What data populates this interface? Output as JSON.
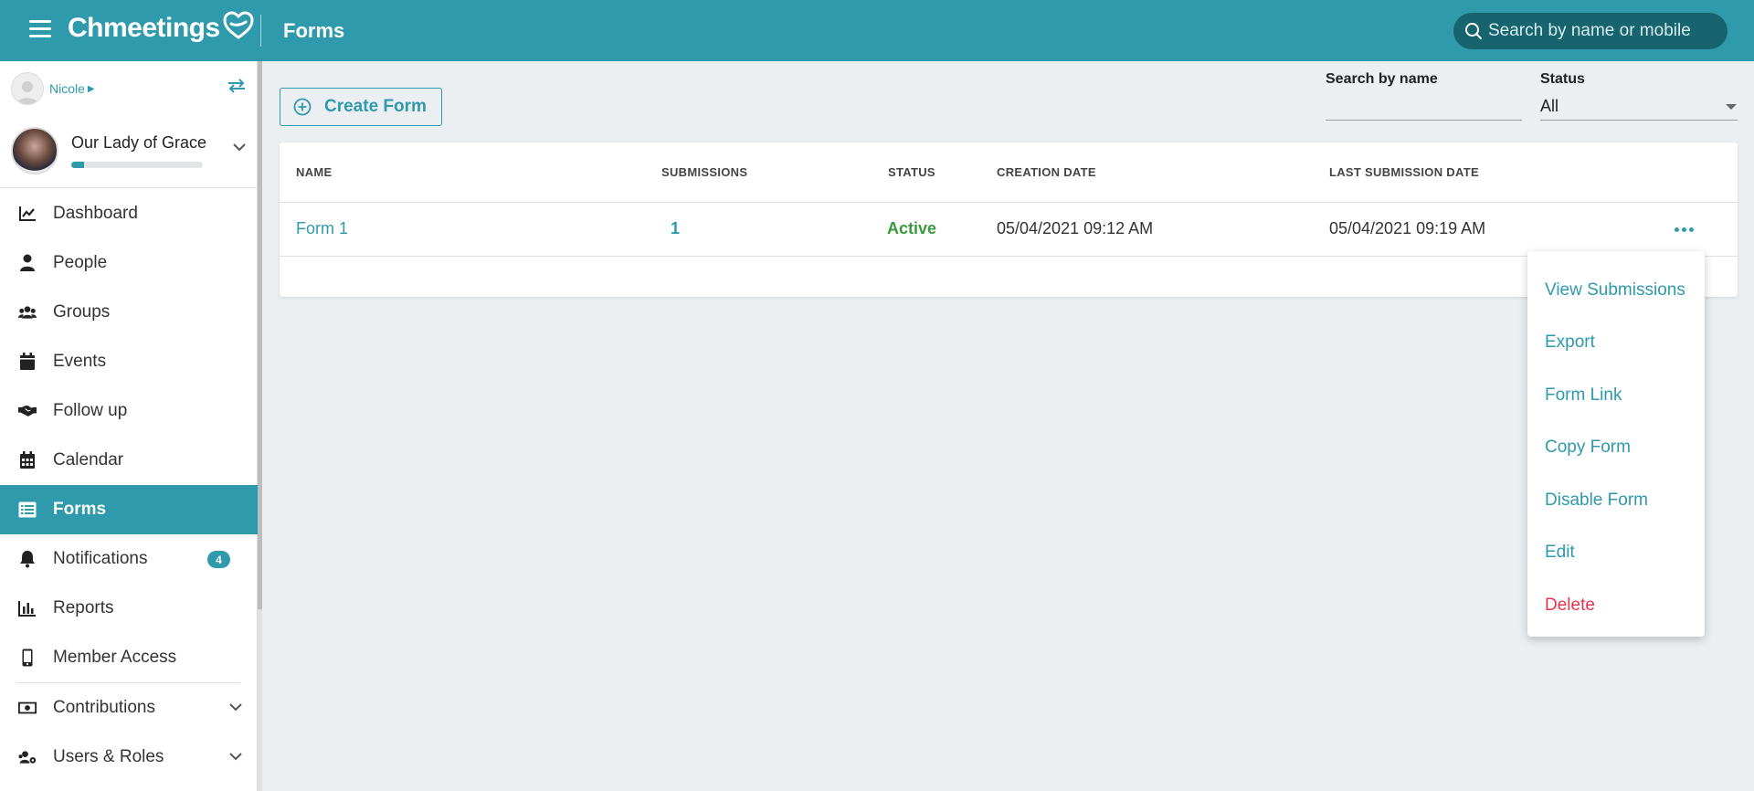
{
  "header": {
    "app_name": "Chmeetings",
    "page_title": "Forms",
    "search_placeholder": "Search by name or mobile"
  },
  "sidebar": {
    "user_name": "Nicole",
    "church_name": "Our Lady of Grace",
    "church_progress_fraction": 0.1,
    "items": [
      {
        "label": "Dashboard",
        "icon": "chart-line-icon"
      },
      {
        "label": "People",
        "icon": "person-icon"
      },
      {
        "label": "Groups",
        "icon": "users-icon"
      },
      {
        "label": "Events",
        "icon": "calendar-icon"
      },
      {
        "label": "Follow up",
        "icon": "handshake-icon"
      },
      {
        "label": "Calendar",
        "icon": "calendar-grid-icon"
      },
      {
        "label": "Forms",
        "icon": "list-icon",
        "active": true
      },
      {
        "label": "Notifications",
        "icon": "bell-icon",
        "badge": "4"
      },
      {
        "label": "Reports",
        "icon": "bar-chart-icon"
      },
      {
        "label": "Member Access",
        "icon": "mobile-icon"
      },
      {
        "label": "Contributions",
        "icon": "money-bill-icon"
      },
      {
        "label": "Users & Roles",
        "icon": "users-cog-icon"
      }
    ]
  },
  "toolbar": {
    "create_label": "Create Form",
    "search_name_label": "Search by name",
    "search_name_value": "",
    "status_label": "Status",
    "status_value": "All"
  },
  "table": {
    "columns": [
      "NAME",
      "SUBMISSIONS",
      "STATUS",
      "CREATION DATE",
      "LAST SUBMISSION DATE"
    ],
    "rows": [
      {
        "name": "Form 1",
        "submissions": "1",
        "status": "Active",
        "creation_date": "05/04/2021 09:12 AM",
        "last_submission_date": "05/04/2021 09:19 AM"
      }
    ]
  },
  "row_menu": {
    "items": [
      "View Submissions",
      "Export",
      "Form Link",
      "Copy Form",
      "Disable Form",
      "Edit",
      "Delete"
    ]
  },
  "colors": {
    "brand": "#2e9aab",
    "active_status": "#3a9a3a",
    "danger": "#e5344e"
  }
}
